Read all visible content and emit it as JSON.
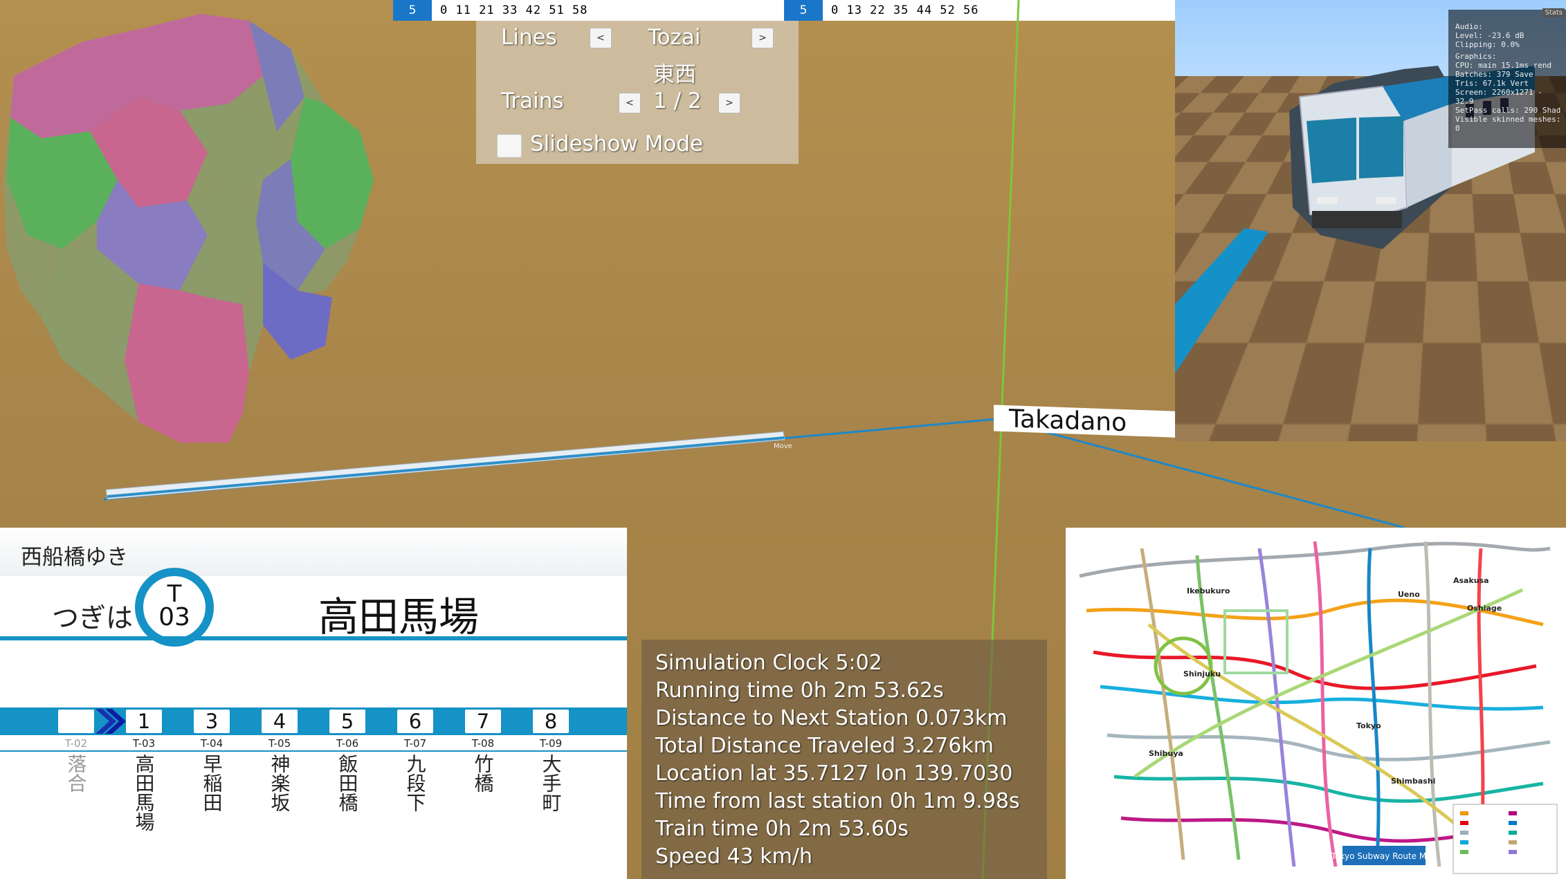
{
  "timetables": [
    {
      "hour": "5",
      "minutes": "0 11 21 33 42 51 58"
    },
    {
      "hour": "5",
      "minutes": "0 13 22 35 44 52 56"
    }
  ],
  "controls": {
    "lines_label": "Lines",
    "line_name": "Tozai",
    "line_name_jp": "東西",
    "trains_label": "Trains",
    "trains_value": "1 / 2",
    "prev": "<",
    "next": ">",
    "slideshow_label": "Slideshow Mode"
  },
  "scene": {
    "station_sign": "Takadano",
    "move_label": "Move"
  },
  "stats_overlay": {
    "tab": "Stats",
    "audio": "Audio:",
    "level": "Level: -23.6 dB",
    "clipping": "Clipping: 0.0%",
    "graphics": "Graphics:",
    "cpu": "CPU: main 15.1ms  rend",
    "batches": "Batches: 379",
    "save": "Save",
    "tris": "Tris: 67.1k",
    "verts": "Vert",
    "screen": "Screen: 2260x1271 - 32.9",
    "setpass": "SetPass calls: 290",
    "shad": "Shad",
    "skinned": "Visible skinned meshes: 0"
  },
  "display": {
    "destination": "西船橋ゆき",
    "next_label": "つぎは",
    "station_letter": "T",
    "station_number": "03",
    "station_name": "高田馬場",
    "stations": [
      {
        "num": "",
        "code": "T-02",
        "name": "落合"
      },
      {
        "num": "1",
        "code": "T-03",
        "name": "高田馬場"
      },
      {
        "num": "3",
        "code": "T-04",
        "name": "早稲田"
      },
      {
        "num": "4",
        "code": "T-05",
        "name": "神楽坂"
      },
      {
        "num": "5",
        "code": "T-06",
        "name": "飯田橋"
      },
      {
        "num": "6",
        "code": "T-07",
        "name": "九段下"
      },
      {
        "num": "7",
        "code": "T-08",
        "name": "竹橋"
      },
      {
        "num": "8",
        "code": "T-09",
        "name": "大手町"
      }
    ]
  },
  "info": {
    "clock": "Simulation Clock 5:02",
    "running": "Running time 0h 2m 53.62s",
    "next_dist": "Distance to Next Station 0.073km",
    "total_dist": "Total Distance Traveled 3.276km",
    "location": "Location lat 35.7127 lon 139.7030",
    "since_last": "Time from last station 0h 1m 9.98s",
    "train_time": "Train time 0h 2m 53.60s",
    "speed": "Speed 43 km/h"
  },
  "subway_map": {
    "title": "Tokyo Subway Route Map",
    "labels": [
      "Ikebukuro",
      "Shinjuku",
      "Shibuya",
      "Tokyo",
      "Ueno",
      "Oshiage",
      "Shimbashi",
      "Asakusa"
    ]
  }
}
